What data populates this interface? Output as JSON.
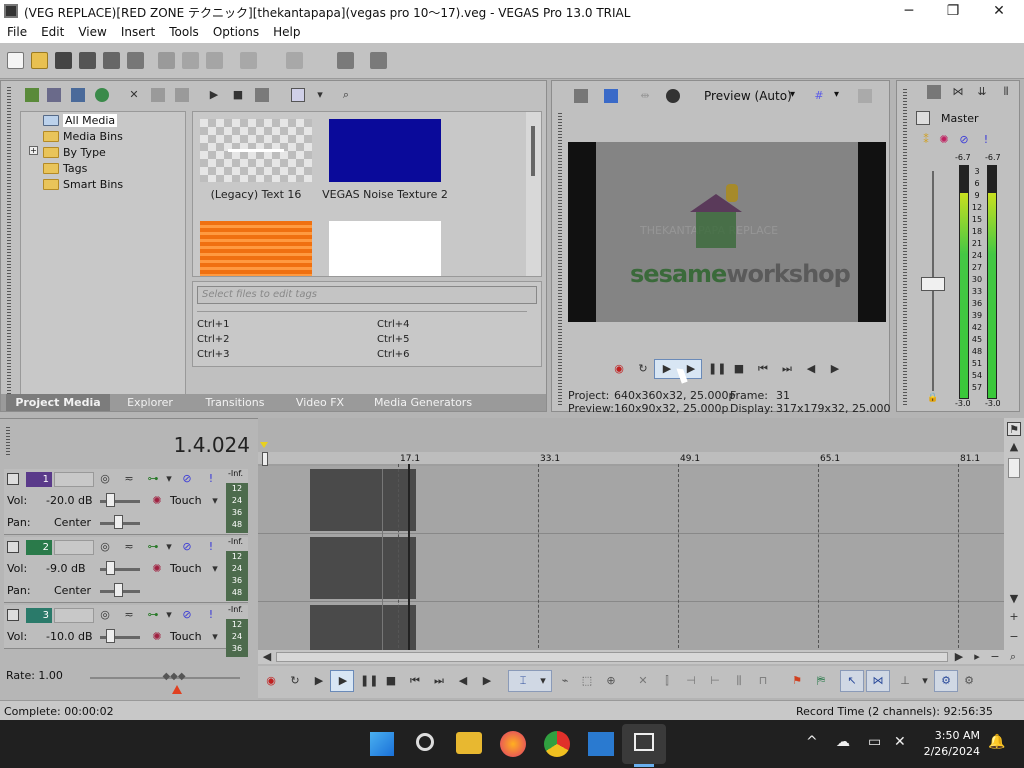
{
  "window": {
    "title": "(VEG REPLACE)[RED ZONE テクニック][thekantapapa](vegas pro 10〜17).veg - VEGAS Pro 13.0 TRIAL",
    "minimize": "─",
    "maximize": "❐",
    "close": "✕"
  },
  "menu": [
    "File",
    "Edit",
    "View",
    "Insert",
    "Tools",
    "Options",
    "Help"
  ],
  "project_media": {
    "tree": [
      {
        "label": "All Media",
        "selected": true
      },
      {
        "label": "Media Bins"
      },
      {
        "label": "By Type",
        "expander": "+"
      },
      {
        "label": "Tags"
      },
      {
        "label": "Smart Bins"
      }
    ],
    "thumbnails": [
      {
        "label": "(Legacy) Text 16",
        "color": "#dcdcdc"
      },
      {
        "label": "VEGAS Noise Texture 2",
        "color": "#0a0a9a"
      },
      {
        "label": "",
        "color": "#f07010"
      },
      {
        "label": "",
        "color": "#ffffff"
      }
    ],
    "tags_placeholder": "Select files to edit tags",
    "shortcuts": [
      "Ctrl+1",
      "Ctrl+2",
      "Ctrl+3",
      "Ctrl+4",
      "Ctrl+5",
      "Ctrl+6"
    ],
    "tabs": [
      "Project Media",
      "Explorer",
      "Transitions",
      "Video FX",
      "Media Generators"
    ],
    "active_tab": "Project Media"
  },
  "preview": {
    "quality_label": "Preview (Auto)",
    "video_text_top": "THEKANTAPAPA REPLACE",
    "video_text_logo_a": "sesame",
    "video_text_logo_b": "workshop",
    "project_label": "Project:",
    "project_value": "640x360x32, 25.000p",
    "preview_label": "Preview:",
    "preview_value": "160x90x32, 25.000p",
    "frame_label": "Frame:",
    "frame_value": "31",
    "display_label": "Display:",
    "display_value": "317x179x32, 25.000"
  },
  "master": {
    "label": "Master",
    "peak_left": "-6.7",
    "peak_right": "-6.7",
    "ticks": [
      "3",
      "6",
      "9",
      "12",
      "15",
      "18",
      "21",
      "24",
      "27",
      "30",
      "33",
      "36",
      "39",
      "42",
      "45",
      "48",
      "51",
      "54",
      "57"
    ],
    "level_left": "-3.0",
    "level_right": "-3.0"
  },
  "timeline": {
    "timecode": "1.4.024",
    "ruler": [
      "17.1",
      "33.1",
      "49.1",
      "65.1",
      "81.1"
    ],
    "rate_label": "Rate: 1.00",
    "tracks": [
      {
        "num": "1",
        "vol": "-20.0 dB",
        "pan": "Center",
        "mode": "Touch",
        "meter_top": "-Inf.",
        "meter_ticks": [
          "12",
          "24",
          "36",
          "48"
        ]
      },
      {
        "num": "2",
        "vol": "-9.0 dB",
        "pan": "Center",
        "mode": "Touch",
        "meter_top": "-Inf.",
        "meter_ticks": [
          "12",
          "24",
          "36",
          "48"
        ]
      },
      {
        "num": "3",
        "vol": "-10.0 dB",
        "pan": "",
        "mode": "Touch",
        "meter_top": "-Inf.",
        "meter_ticks": [
          "12",
          "24",
          "36"
        ]
      }
    ],
    "vol_label": "Vol:",
    "pan_label": "Pan:"
  },
  "status": {
    "complete": "Complete: 00:00:02",
    "record_time": "Record Time (2 channels): 92:56:35"
  },
  "taskbar": {
    "time": "3:50 AM",
    "date": "2/26/2024"
  }
}
